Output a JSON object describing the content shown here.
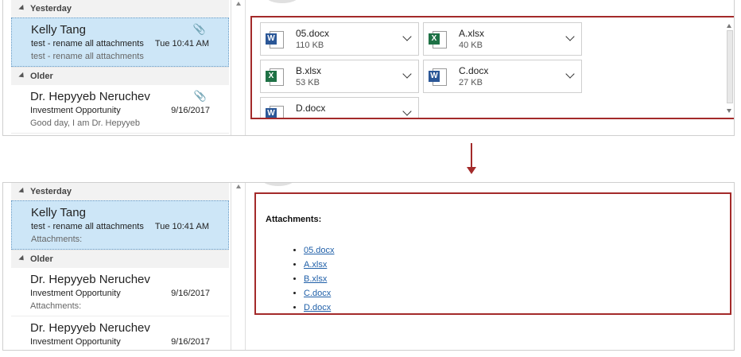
{
  "top": {
    "groups": [
      {
        "label": "Yesterday"
      },
      {
        "label": "Older"
      }
    ],
    "messages": [
      {
        "sender": "Kelly Tang",
        "subject": "test - rename all attachments",
        "time": "Tue 10:41 AM",
        "preview": "test - rename all attachments"
      },
      {
        "sender": "Dr. Hepyyeb Neruchev",
        "subject": "Investment Opportunity",
        "time": "9/16/2017",
        "preview": "Good day,  I am Dr. Hepyyeb"
      }
    ],
    "attachments": [
      {
        "name": "05.docx",
        "size": "110 KB",
        "type": "word",
        "badge": "W"
      },
      {
        "name": "A.xlsx",
        "size": "40 KB",
        "type": "excel",
        "badge": "X"
      },
      {
        "name": "B.xlsx",
        "size": "53 KB",
        "type": "excel",
        "badge": "X"
      },
      {
        "name": "C.docx",
        "size": "27 KB",
        "type": "word",
        "badge": "W"
      },
      {
        "name": "D.docx",
        "size": "",
        "type": "word",
        "badge": "W"
      }
    ]
  },
  "bottom": {
    "groups": [
      {
        "label": "Yesterday"
      },
      {
        "label": "Older"
      }
    ],
    "messages": [
      {
        "sender": "Kelly Tang",
        "subject": "test - rename all attachments",
        "time": "Tue 10:41 AM",
        "preview": "Attachments:"
      },
      {
        "sender": "Dr. Hepyyeb Neruchev",
        "subject": "Investment Opportunity",
        "time": "9/16/2017",
        "preview": "Attachments:"
      },
      {
        "sender": "Dr. Hepyyeb Neruchev",
        "subject": "Investment Opportunity",
        "time": "9/16/2017",
        "preview": ""
      }
    ],
    "body": {
      "title": "Attachments:",
      "links": [
        "05.docx",
        "A.xlsx",
        "B.xlsx",
        "C.docx",
        "D.docx"
      ]
    }
  },
  "icons": {
    "clip": "paperclip-icon",
    "word": "word-file-icon",
    "excel": "excel-file-icon"
  },
  "colors": {
    "highlight": "#a32a2a",
    "selected_bg": "#cde6f7",
    "link": "#1f5fa8"
  }
}
